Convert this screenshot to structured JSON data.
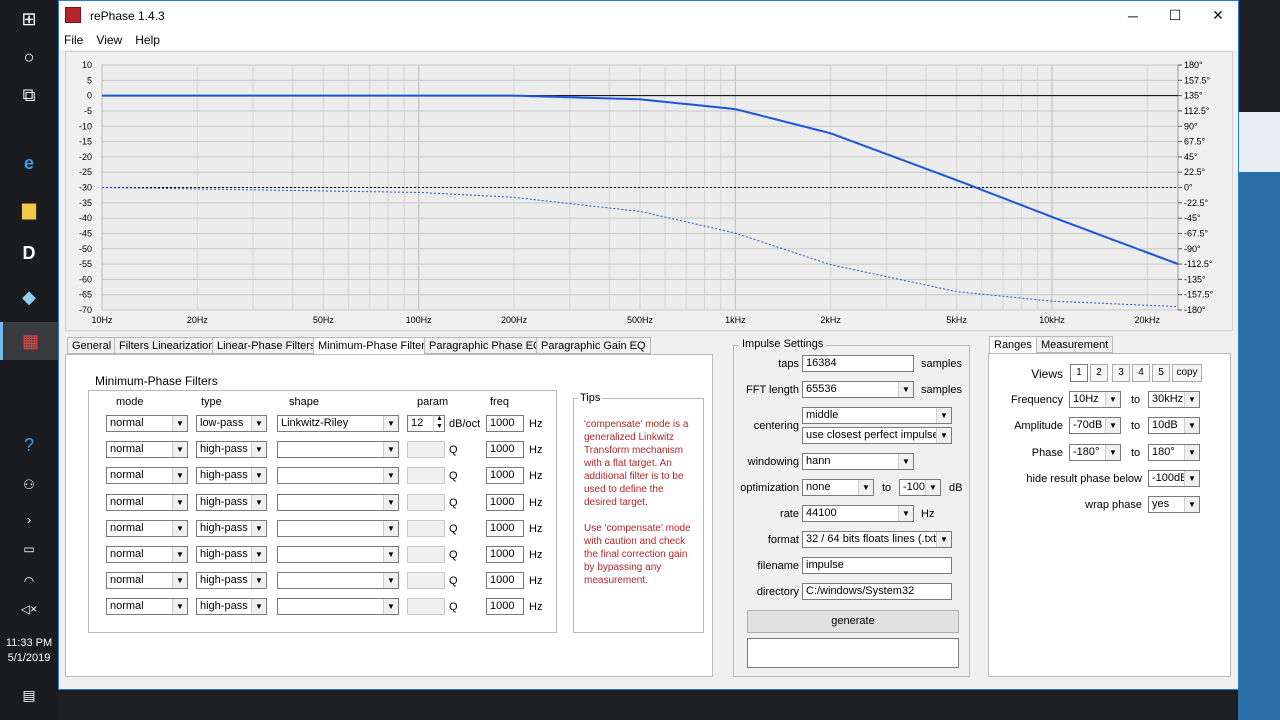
{
  "taskbar": {
    "clock_time": "11:33 PM",
    "clock_date": "5/1/2019"
  },
  "window": {
    "title": "rePhase 1.4.3",
    "minimize": "─",
    "maximize": "☐",
    "close": "✕"
  },
  "menu": [
    "File",
    "View",
    "Help"
  ],
  "graph": {
    "y_left_ticks": [
      "10",
      "5",
      "0",
      "-5",
      "-10",
      "-15",
      "-20",
      "-25",
      "-30",
      "-35",
      "-40",
      "-45",
      "-50",
      "-55",
      "-60",
      "-65",
      "-70"
    ],
    "y_right_ticks": [
      "180°",
      "157.5°",
      "135°",
      "112.5°",
      "90°",
      "67.5°",
      "45°",
      "22.5°",
      "0°",
      "-22.5°",
      "-45°",
      "-67.5°",
      "-90°",
      "-112.5°",
      "-135°",
      "-157.5°",
      "-180°"
    ],
    "x_ticks": [
      "10Hz",
      "20Hz",
      "50Hz",
      "100Hz",
      "200Hz",
      "500Hz",
      "1kHz",
      "2kHz",
      "5kHz",
      "10kHz",
      "20kHz"
    ]
  },
  "chart_data": {
    "type": "line",
    "title": "",
    "x_scale": "log",
    "xlim": [
      10,
      25000
    ],
    "ylim": [
      -70,
      10
    ],
    "y2lim": [
      -180,
      180
    ],
    "y2_unit": "°",
    "grid": true,
    "series": [
      {
        "style": "solid",
        "axis": "left",
        "x": [
          10,
          100,
          200,
          500,
          1000,
          2000,
          5000,
          10000,
          25000
        ],
        "values": [
          0,
          0,
          0,
          -1.2,
          -4.4,
          -12.3,
          -27.6,
          -39.6,
          -55
        ]
      },
      {
        "style": "dotted",
        "axis": "right",
        "x": [
          10,
          100,
          200,
          500,
          1000,
          2000,
          5000,
          10000,
          25000
        ],
        "values": [
          0,
          -7.2,
          -14.4,
          -35.1,
          -67,
          -113.4,
          -153,
          -167,
          -175
        ]
      }
    ]
  },
  "tabs": [
    "General",
    "Filters Linearization",
    "Linear-Phase Filters",
    "Minimum-Phase Filters",
    "Paragraphic Phase EQ",
    "Paragraphic Gain EQ"
  ],
  "selected_tab": "Minimum-Phase Filters",
  "mpf": {
    "group_title": "Minimum-Phase Filters",
    "headers": {
      "mode": "mode",
      "type": "type",
      "shape": "shape",
      "param": "param",
      "freq": "freq"
    },
    "rows": [
      {
        "mode": "normal",
        "type": "low-pass",
        "shape": "Linkwitz-Riley",
        "param": "12",
        "unit": "dB/oct",
        "freq": "1000",
        "hz": "Hz"
      },
      {
        "mode": "normal",
        "type": "high-pass",
        "shape": "",
        "param": "",
        "unit": "Q",
        "freq": "1000",
        "hz": "Hz"
      },
      {
        "mode": "normal",
        "type": "high-pass",
        "shape": "",
        "param": "",
        "unit": "Q",
        "freq": "1000",
        "hz": "Hz"
      },
      {
        "mode": "normal",
        "type": "high-pass",
        "shape": "",
        "param": "",
        "unit": "Q",
        "freq": "1000",
        "hz": "Hz"
      },
      {
        "mode": "normal",
        "type": "high-pass",
        "shape": "",
        "param": "",
        "unit": "Q",
        "freq": "1000",
        "hz": "Hz"
      },
      {
        "mode": "normal",
        "type": "high-pass",
        "shape": "",
        "param": "",
        "unit": "Q",
        "freq": "1000",
        "hz": "Hz"
      },
      {
        "mode": "normal",
        "type": "high-pass",
        "shape": "",
        "param": "",
        "unit": "Q",
        "freq": "1000",
        "hz": "Hz"
      },
      {
        "mode": "normal",
        "type": "high-pass",
        "shape": "",
        "param": "",
        "unit": "Q",
        "freq": "1000",
        "hz": "Hz"
      }
    ]
  },
  "tips": {
    "title": "Tips",
    "p1": "'compensate' mode is a generalized Linkwitz Transform mechanism with a flat target. An additional filter is to be used to define the desired target.",
    "p2": "Use 'compensate' mode with caution and check the final correction gain by bypassing any measurement."
  },
  "impulse": {
    "title": "Impulse Settings",
    "taps_label": "taps",
    "taps": "16384",
    "taps_unit": "samples",
    "fft_label": "FFT length",
    "fft": "65536",
    "fft_unit": "samples",
    "centering_label": "centering",
    "centering": "middle",
    "centering2": "use closest perfect impulse",
    "windowing_label": "windowing",
    "windowing": "hann",
    "optimization_label": "optimization",
    "optimization": "none",
    "opt_to": "to",
    "opt_val": "-100",
    "opt_unit": "dB",
    "rate_label": "rate",
    "rate": "44100",
    "rate_unit": "Hz",
    "format_label": "format",
    "format": "32 / 64 bits floats lines (.txt)",
    "filename_label": "filename",
    "filename": "impulse",
    "directory_label": "directory",
    "directory": "C:/windows/System32",
    "generate": "generate"
  },
  "ranges": {
    "tabs": [
      "Ranges",
      "Measurement"
    ],
    "views_label": "Views",
    "views": [
      "1",
      "2",
      "3",
      "4",
      "5"
    ],
    "copy": "copy",
    "frequency_label": "Frequency",
    "freq_from": "10Hz",
    "freq_to": "30kHz",
    "amplitude_label": "Amplitude",
    "amp_from": "-70dB",
    "amp_to": "10dB",
    "phase_label": "Phase",
    "phase_from": "-180°",
    "phase_to": "180°",
    "to": "to",
    "hide_label": "hide result phase below",
    "hide": "-100dB",
    "wrap_label": "wrap phase",
    "wrap": "yes"
  }
}
